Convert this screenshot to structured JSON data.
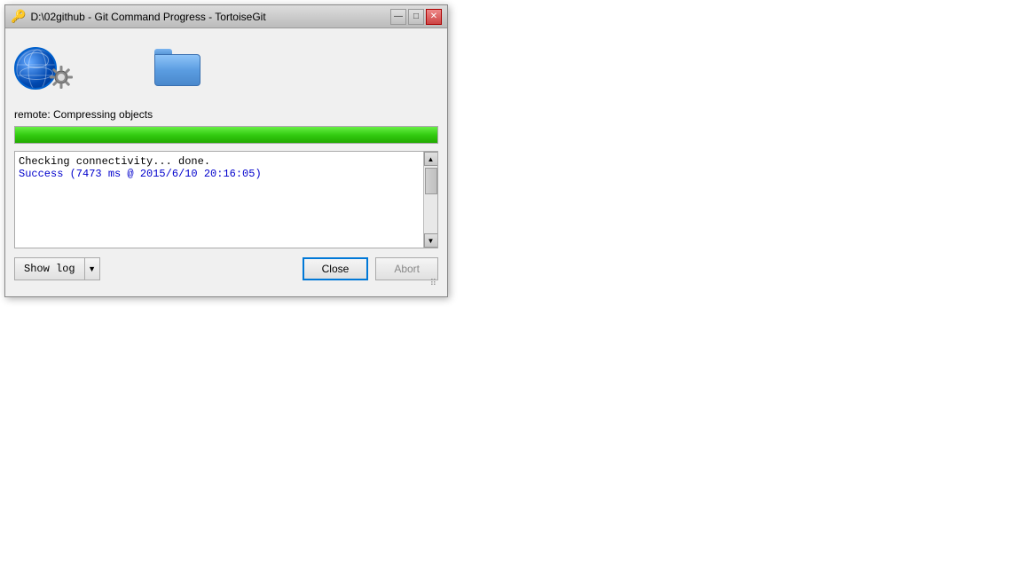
{
  "window": {
    "title": "D:\\02github - Git Command Progress - TortoiseGit",
    "title_icon": "🔑"
  },
  "icons": {
    "globe_alt": "globe",
    "gear_alt": "gear",
    "folder_alt": "folder"
  },
  "status": {
    "text": "remote: Compressing objects"
  },
  "progress": {
    "value": 100,
    "fill_color": "#33cc11"
  },
  "log": {
    "lines": [
      {
        "type": "normal",
        "text": "Checking connectivity... done."
      },
      {
        "type": "success",
        "text": "Success (7473 ms @ 2015/6/10 20:16:05)"
      }
    ]
  },
  "buttons": {
    "show_log": "Show log",
    "close": "Close",
    "abort": "Abort"
  },
  "title_buttons": {
    "minimize": "—",
    "restore": "□",
    "close": "✕"
  }
}
